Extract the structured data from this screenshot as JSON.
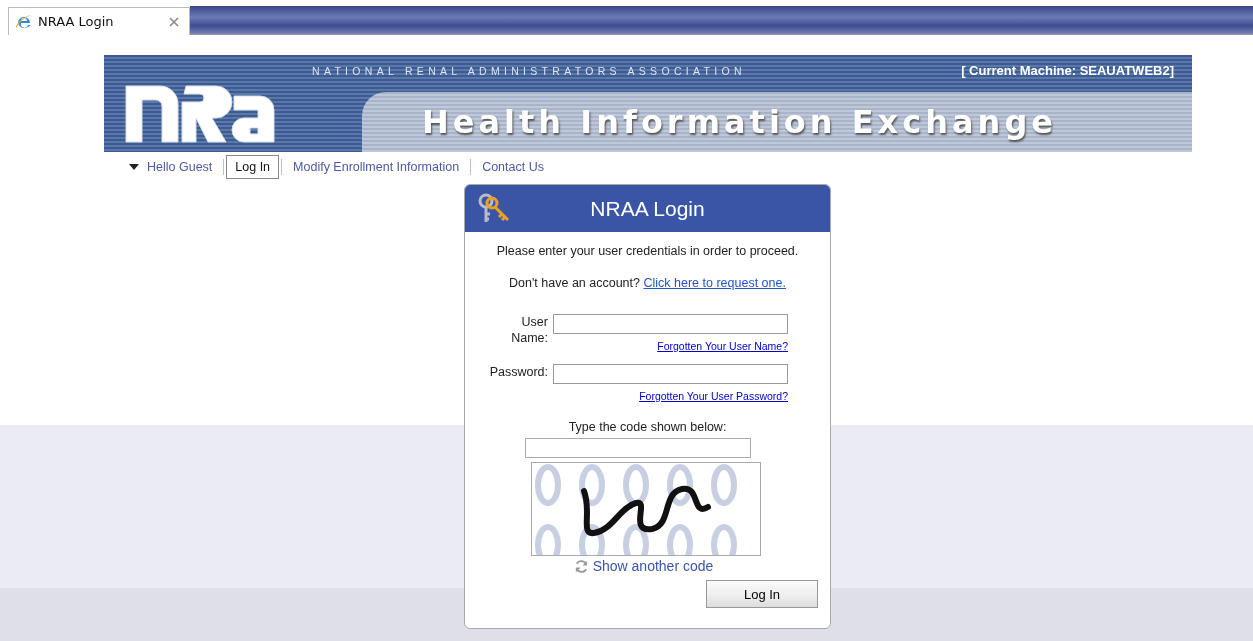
{
  "browser_tab": {
    "title": "NRAA Login"
  },
  "banner": {
    "organization": "NATIONAL RENAL ADMINISTRATORS ASSOCIATION",
    "machine": "[ Current Machine: SEAUATWEB2]",
    "title": "Health Information Exchange"
  },
  "nav": [
    {
      "label": "Hello Guest",
      "kind": "menu",
      "selected": false
    },
    {
      "label": "Log In",
      "kind": "link",
      "selected": true
    },
    {
      "label": "Modify Enrollment Information",
      "kind": "link",
      "selected": false
    },
    {
      "label": "Contact Us",
      "kind": "link",
      "selected": false
    }
  ],
  "login": {
    "title": "NRAA Login",
    "intro": "Please enter your user credentials in order to proceed.",
    "account_prompt": "Don't have an account?",
    "request_link": "Click here to request one.",
    "fields": [
      {
        "label": "User Name:",
        "help_link": "Forgotten Your User Name?"
      },
      {
        "label": "Password:",
        "help_link": "Forgotten Your User Password?"
      }
    ],
    "captcha_label": "Type the code shown below:",
    "refresh_link": "Show another code",
    "submit": "Log In"
  }
}
